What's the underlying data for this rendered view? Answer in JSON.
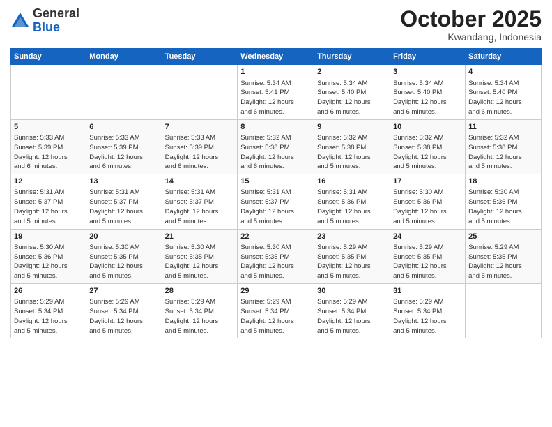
{
  "header": {
    "logo_general": "General",
    "logo_blue": "Blue",
    "month": "October 2025",
    "location": "Kwandang, Indonesia"
  },
  "days_of_week": [
    "Sunday",
    "Monday",
    "Tuesday",
    "Wednesday",
    "Thursday",
    "Friday",
    "Saturday"
  ],
  "weeks": [
    [
      {
        "day": "",
        "info": ""
      },
      {
        "day": "",
        "info": ""
      },
      {
        "day": "",
        "info": ""
      },
      {
        "day": "1",
        "info": "Sunrise: 5:34 AM\nSunset: 5:41 PM\nDaylight: 12 hours\nand 6 minutes."
      },
      {
        "day": "2",
        "info": "Sunrise: 5:34 AM\nSunset: 5:40 PM\nDaylight: 12 hours\nand 6 minutes."
      },
      {
        "day": "3",
        "info": "Sunrise: 5:34 AM\nSunset: 5:40 PM\nDaylight: 12 hours\nand 6 minutes."
      },
      {
        "day": "4",
        "info": "Sunrise: 5:34 AM\nSunset: 5:40 PM\nDaylight: 12 hours\nand 6 minutes."
      }
    ],
    [
      {
        "day": "5",
        "info": "Sunrise: 5:33 AM\nSunset: 5:39 PM\nDaylight: 12 hours\nand 6 minutes."
      },
      {
        "day": "6",
        "info": "Sunrise: 5:33 AM\nSunset: 5:39 PM\nDaylight: 12 hours\nand 6 minutes."
      },
      {
        "day": "7",
        "info": "Sunrise: 5:33 AM\nSunset: 5:39 PM\nDaylight: 12 hours\nand 6 minutes."
      },
      {
        "day": "8",
        "info": "Sunrise: 5:32 AM\nSunset: 5:38 PM\nDaylight: 12 hours\nand 6 minutes."
      },
      {
        "day": "9",
        "info": "Sunrise: 5:32 AM\nSunset: 5:38 PM\nDaylight: 12 hours\nand 5 minutes."
      },
      {
        "day": "10",
        "info": "Sunrise: 5:32 AM\nSunset: 5:38 PM\nDaylight: 12 hours\nand 5 minutes."
      },
      {
        "day": "11",
        "info": "Sunrise: 5:32 AM\nSunset: 5:38 PM\nDaylight: 12 hours\nand 5 minutes."
      }
    ],
    [
      {
        "day": "12",
        "info": "Sunrise: 5:31 AM\nSunset: 5:37 PM\nDaylight: 12 hours\nand 5 minutes."
      },
      {
        "day": "13",
        "info": "Sunrise: 5:31 AM\nSunset: 5:37 PM\nDaylight: 12 hours\nand 5 minutes."
      },
      {
        "day": "14",
        "info": "Sunrise: 5:31 AM\nSunset: 5:37 PM\nDaylight: 12 hours\nand 5 minutes."
      },
      {
        "day": "15",
        "info": "Sunrise: 5:31 AM\nSunset: 5:37 PM\nDaylight: 12 hours\nand 5 minutes."
      },
      {
        "day": "16",
        "info": "Sunrise: 5:31 AM\nSunset: 5:36 PM\nDaylight: 12 hours\nand 5 minutes."
      },
      {
        "day": "17",
        "info": "Sunrise: 5:30 AM\nSunset: 5:36 PM\nDaylight: 12 hours\nand 5 minutes."
      },
      {
        "day": "18",
        "info": "Sunrise: 5:30 AM\nSunset: 5:36 PM\nDaylight: 12 hours\nand 5 minutes."
      }
    ],
    [
      {
        "day": "19",
        "info": "Sunrise: 5:30 AM\nSunset: 5:36 PM\nDaylight: 12 hours\nand 5 minutes."
      },
      {
        "day": "20",
        "info": "Sunrise: 5:30 AM\nSunset: 5:35 PM\nDaylight: 12 hours\nand 5 minutes."
      },
      {
        "day": "21",
        "info": "Sunrise: 5:30 AM\nSunset: 5:35 PM\nDaylight: 12 hours\nand 5 minutes."
      },
      {
        "day": "22",
        "info": "Sunrise: 5:30 AM\nSunset: 5:35 PM\nDaylight: 12 hours\nand 5 minutes."
      },
      {
        "day": "23",
        "info": "Sunrise: 5:29 AM\nSunset: 5:35 PM\nDaylight: 12 hours\nand 5 minutes."
      },
      {
        "day": "24",
        "info": "Sunrise: 5:29 AM\nSunset: 5:35 PM\nDaylight: 12 hours\nand 5 minutes."
      },
      {
        "day": "25",
        "info": "Sunrise: 5:29 AM\nSunset: 5:35 PM\nDaylight: 12 hours\nand 5 minutes."
      }
    ],
    [
      {
        "day": "26",
        "info": "Sunrise: 5:29 AM\nSunset: 5:34 PM\nDaylight: 12 hours\nand 5 minutes."
      },
      {
        "day": "27",
        "info": "Sunrise: 5:29 AM\nSunset: 5:34 PM\nDaylight: 12 hours\nand 5 minutes."
      },
      {
        "day": "28",
        "info": "Sunrise: 5:29 AM\nSunset: 5:34 PM\nDaylight: 12 hours\nand 5 minutes."
      },
      {
        "day": "29",
        "info": "Sunrise: 5:29 AM\nSunset: 5:34 PM\nDaylight: 12 hours\nand 5 minutes."
      },
      {
        "day": "30",
        "info": "Sunrise: 5:29 AM\nSunset: 5:34 PM\nDaylight: 12 hours\nand 5 minutes."
      },
      {
        "day": "31",
        "info": "Sunrise: 5:29 AM\nSunset: 5:34 PM\nDaylight: 12 hours\nand 5 minutes."
      },
      {
        "day": "",
        "info": ""
      }
    ]
  ]
}
